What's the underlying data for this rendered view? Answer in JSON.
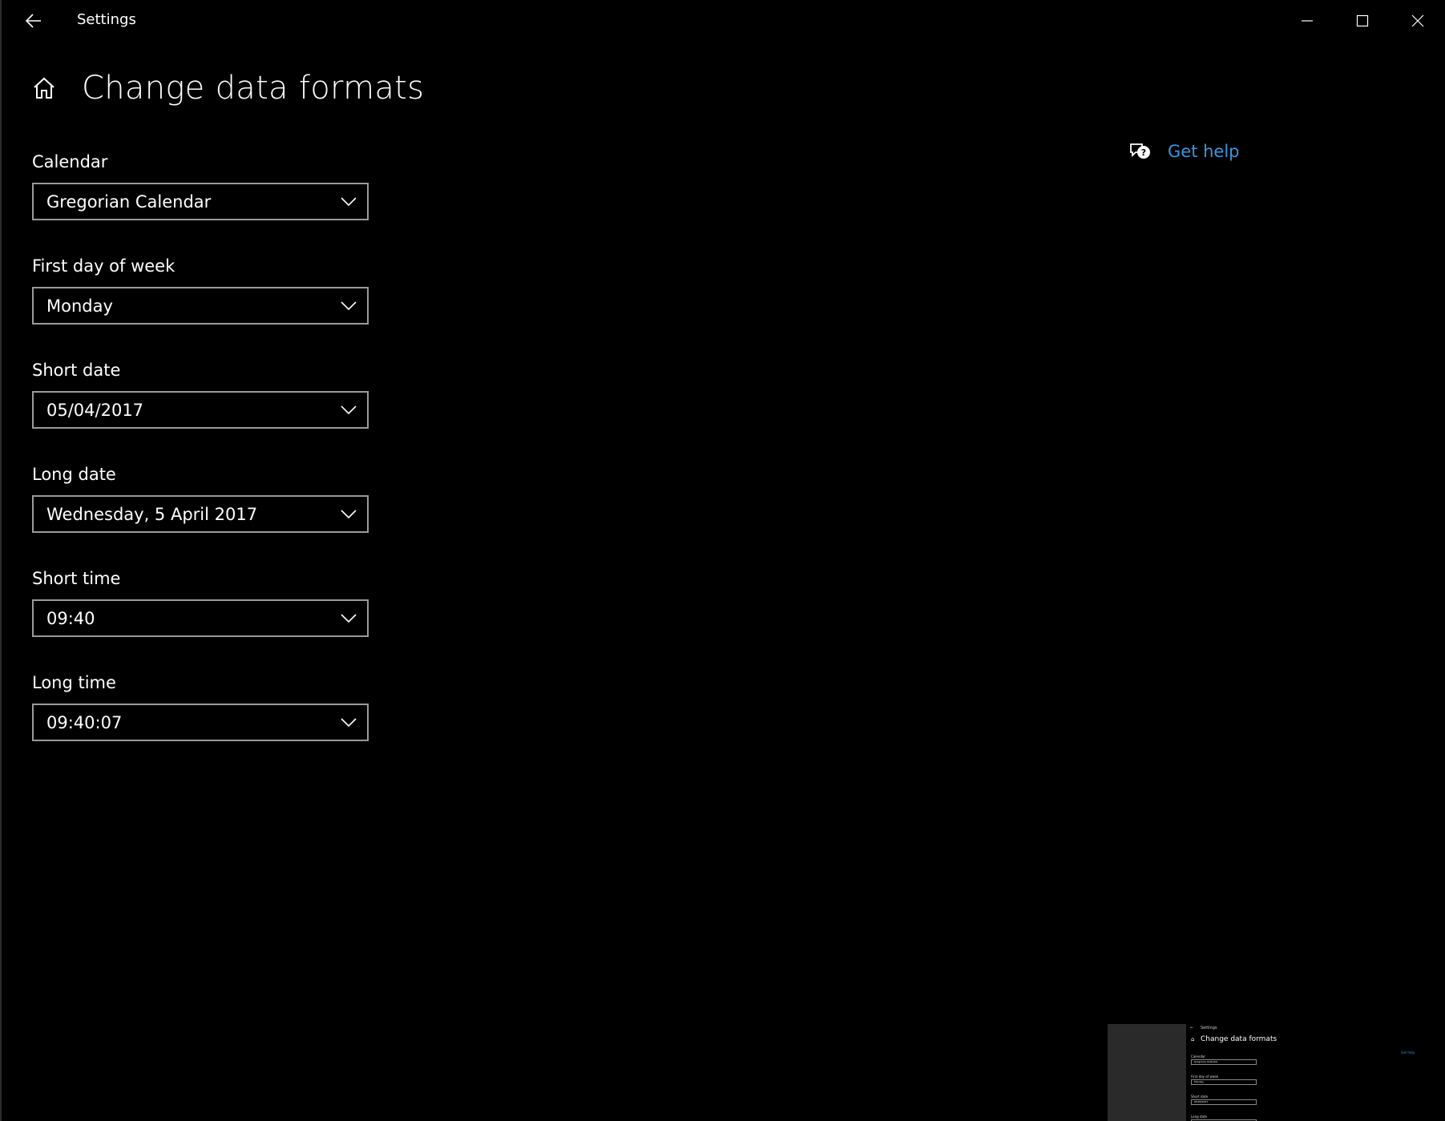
{
  "window": {
    "title": "Settings",
    "controls": {
      "minimize": "minimize-icon",
      "maximize": "maximize-icon",
      "close": "close-icon"
    }
  },
  "header": {
    "title": "Change data formats"
  },
  "help": {
    "label": "Get help"
  },
  "fields": [
    {
      "label": "Calendar",
      "value": "Gregorian Calendar"
    },
    {
      "label": "First day of week",
      "value": "Monday"
    },
    {
      "label": "Short date",
      "value": "05/04/2017"
    },
    {
      "label": "Long date",
      "value": "Wednesday, 5 April 2017"
    },
    {
      "label": "Short time",
      "value": "09:40"
    },
    {
      "label": "Long time",
      "value": "09:40:07"
    }
  ],
  "thumbnail": {
    "window_title": "Settings",
    "page_title": "Change data formats",
    "help_label": "Get help",
    "fields": [
      {
        "label": "Calendar",
        "value": "Gregorian Calendar"
      },
      {
        "label": "First day of week",
        "value": "Monday"
      },
      {
        "label": "Short date",
        "value": "05/04/2017"
      },
      {
        "label": "Long date",
        "value": ""
      }
    ]
  },
  "colors": {
    "background": "#000000",
    "text": "#ffffff",
    "accent_link": "#3a96dd",
    "combo_border": "#9a9a9a"
  }
}
